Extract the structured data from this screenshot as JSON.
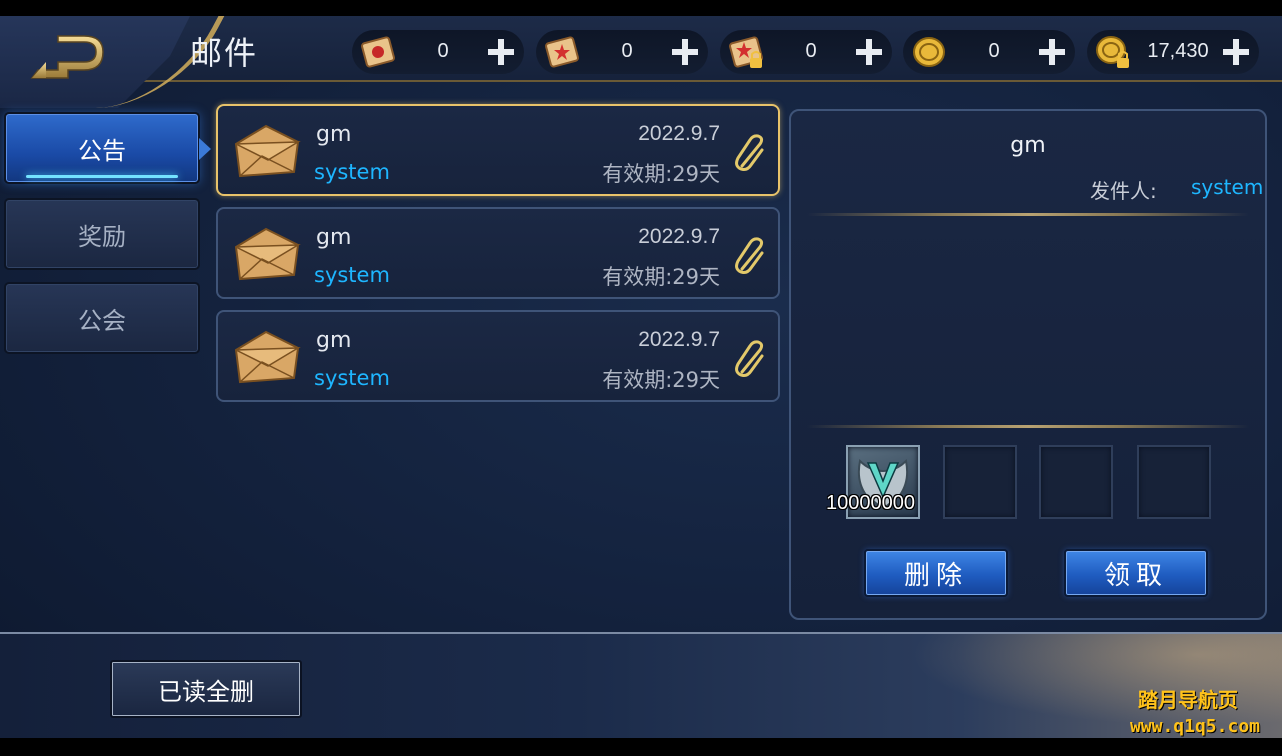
{
  "header": {
    "title": "邮件",
    "back_icon": "back-arrow-icon"
  },
  "currencies": [
    {
      "name": "red-scroll",
      "icon": "red-scroll-icon",
      "value": "0"
    },
    {
      "name": "star-scroll",
      "icon": "star-scroll-icon",
      "value": "0"
    },
    {
      "name": "locked-scroll",
      "icon": "locked-scroll-icon",
      "value": "0"
    },
    {
      "name": "gold-coin",
      "icon": "gold-coin-icon",
      "value": "0"
    },
    {
      "name": "locked-coin",
      "icon": "locked-coin-icon",
      "value": "17,430"
    }
  ],
  "tabs": [
    {
      "label": "公告",
      "active": true
    },
    {
      "label": "奖励",
      "active": false
    },
    {
      "label": "公会",
      "active": false
    }
  ],
  "mails": [
    {
      "title": "gm",
      "sender": "system",
      "date": "2022.9.7",
      "expire": "有效期:29天",
      "selected": true
    },
    {
      "title": "gm",
      "sender": "system",
      "date": "2022.9.7",
      "expire": "有效期:29天",
      "selected": false
    },
    {
      "title": "gm",
      "sender": "system",
      "date": "2022.9.7",
      "expire": "有效期:29天",
      "selected": false
    }
  ],
  "detail": {
    "title": "gm",
    "sender_label": "发件人:",
    "sender": "system",
    "attachments": [
      {
        "icon": "v-emblem-icon",
        "quantity": "10000000"
      },
      null,
      null,
      null
    ],
    "delete_label": "删除",
    "claim_label": "领取"
  },
  "footer": {
    "delete_read_label": "已读全删"
  },
  "watermark": {
    "line1": "踏月导航页",
    "line2": "www.q1q5.com"
  },
  "colors": {
    "accent_blue": "#1eb6ff",
    "selected_border": "#e8c36a",
    "watermark": "#ffc21a"
  }
}
